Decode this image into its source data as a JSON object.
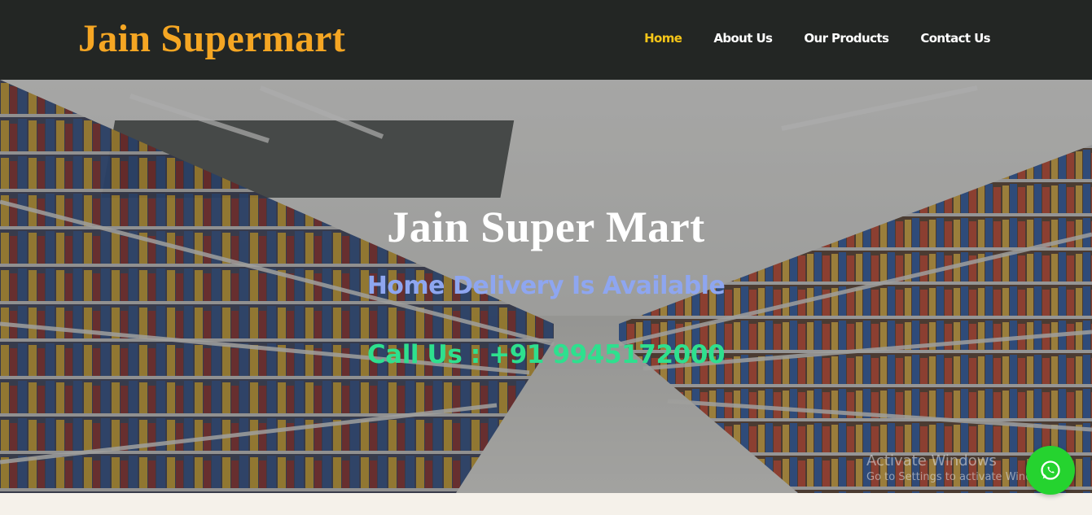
{
  "header": {
    "brand": "Jain Supermart",
    "nav": [
      {
        "label": "Home",
        "active": true
      },
      {
        "label": "About Us",
        "active": false
      },
      {
        "label": "Our Products",
        "active": false
      },
      {
        "label": "Contact Us",
        "active": false
      }
    ]
  },
  "hero": {
    "title": "Jain Super Mart",
    "subtitle": "Home Delivery Is Available",
    "call": "Call Us : +91 9945172000"
  },
  "watermark": {
    "title": "Activate Windows",
    "subtitle": "Go to Settings to activate Windows."
  },
  "icons": {
    "whatsapp": "whatsapp-icon"
  },
  "colors": {
    "brand": "#f5a623",
    "nav_active": "#f5c518",
    "subtitle": "#8ea6f0",
    "call": "#2ee08e",
    "whatsapp": "#25d32f"
  }
}
